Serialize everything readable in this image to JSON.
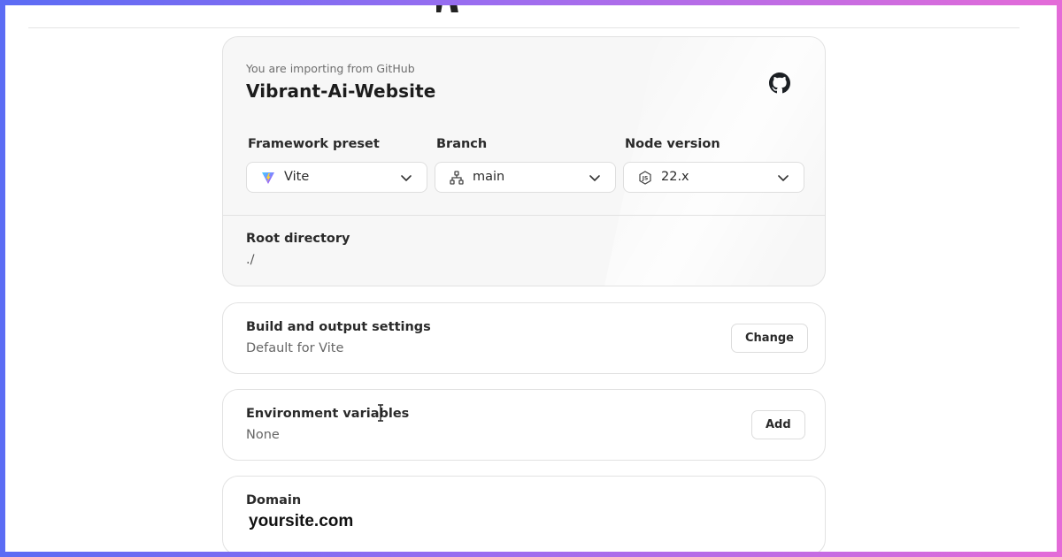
{
  "header": {
    "logo_icon": "vercel-logo-icon"
  },
  "import_card": {
    "source_label": "You are importing from GitHub",
    "repo_name": "Vibrant-Ai-Website",
    "provider_icon": "github-icon",
    "fields": {
      "framework": {
        "label": "Framework preset",
        "value": "Vite",
        "icon": "vite-logo-icon"
      },
      "branch": {
        "label": "Branch",
        "value": "main",
        "icon": "git-branch-icon"
      },
      "node": {
        "label": "Node version",
        "value": "22.x",
        "icon": "nodejs-icon"
      }
    },
    "root_directory": {
      "label": "Root directory",
      "value": "./"
    }
  },
  "build_settings": {
    "title": "Build and output settings",
    "subtitle": "Default for Vite",
    "button_label": "Change"
  },
  "env_vars": {
    "title": "Environment variables",
    "subtitle": "None",
    "button_label": "Add"
  },
  "domain": {
    "title": "Domain",
    "value": "yoursite.com"
  },
  "colors": {
    "frame_gradient_start": "#5b6cf4",
    "frame_gradient_end": "#e46bd8",
    "card_border": "#e2e2e2",
    "text_primary": "#1c1c1c"
  }
}
